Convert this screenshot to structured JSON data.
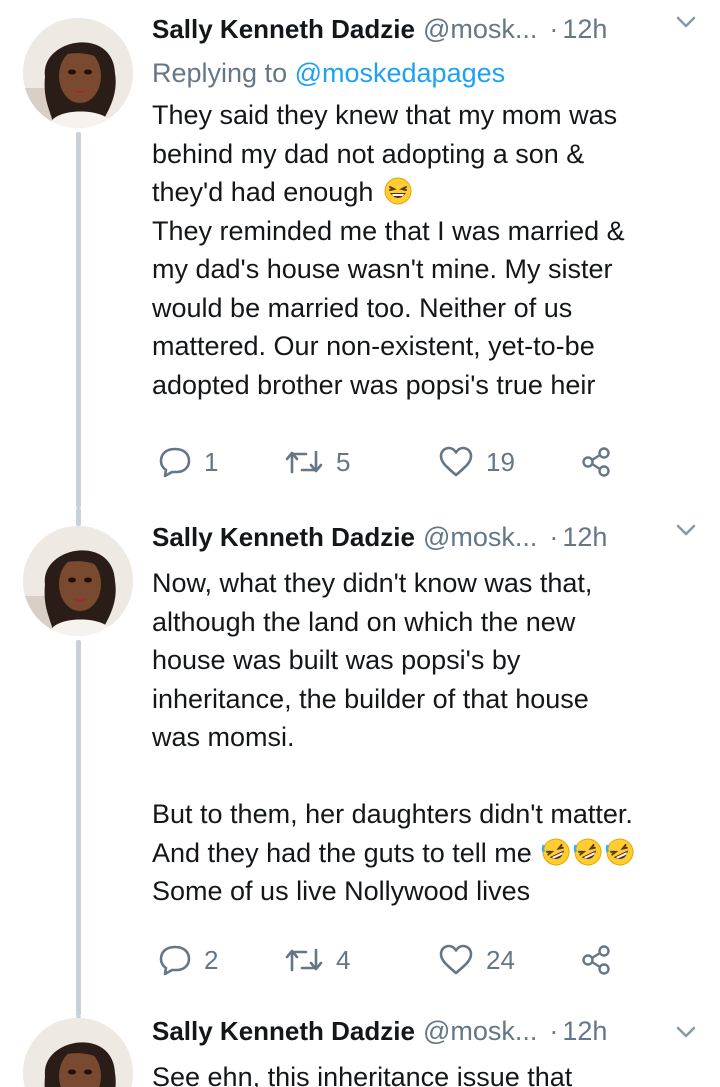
{
  "tweets": [
    {
      "author_name": "Sally Kenneth Dadzie",
      "handle": "@mosk...",
      "dot": "·",
      "time": "12h",
      "replying_label": "Replying to ",
      "replying_handle": "@moskedapages",
      "lines": [
        "They said they knew that my mom was",
        "behind my dad not adopting a son &",
        "they'd had enough",
        "They reminded me that I was married &",
        "my dad's house wasn't mine. My sister",
        "would be married too. Neither of us",
        "mattered. Our non-existent, yet-to-be",
        "adopted brother was popsi's true heir"
      ],
      "replies": "1",
      "retweets": "5",
      "likes": "19"
    },
    {
      "author_name": "Sally Kenneth Dadzie",
      "handle": "@mosk...",
      "dot": "·",
      "time": "12h",
      "lines": [
        "Now, what they didn't know was that,",
        "although the land on which the new",
        "house was built was popsi's by",
        "inheritance, the builder of that house",
        "was momsi.",
        "",
        "But to them, her daughters didn't matter.",
        "And they had the guts to tell me",
        "Some of us live Nollywood lives"
      ],
      "replies": "2",
      "retweets": "4",
      "likes": "24"
    },
    {
      "author_name": "Sally Kenneth Dadzie",
      "handle": "@mosk...",
      "dot": "·",
      "time": "12h",
      "lines": [
        "See ehn, this inheritance issue that"
      ]
    }
  ],
  "colors": {
    "text": "#14171a",
    "secondary": "#657786",
    "link": "#1da1f2",
    "thread_line": "#c9d1d8"
  },
  "icons": {
    "grinning_emoji": "grinning-squinting-face-icon",
    "laughing_emoji": "rolling-on-floor-laughing-icon",
    "reply": "reply-icon",
    "retweet": "retweet-icon",
    "like": "heart-icon",
    "share": "share-icon",
    "caret": "chevron-down-icon"
  }
}
